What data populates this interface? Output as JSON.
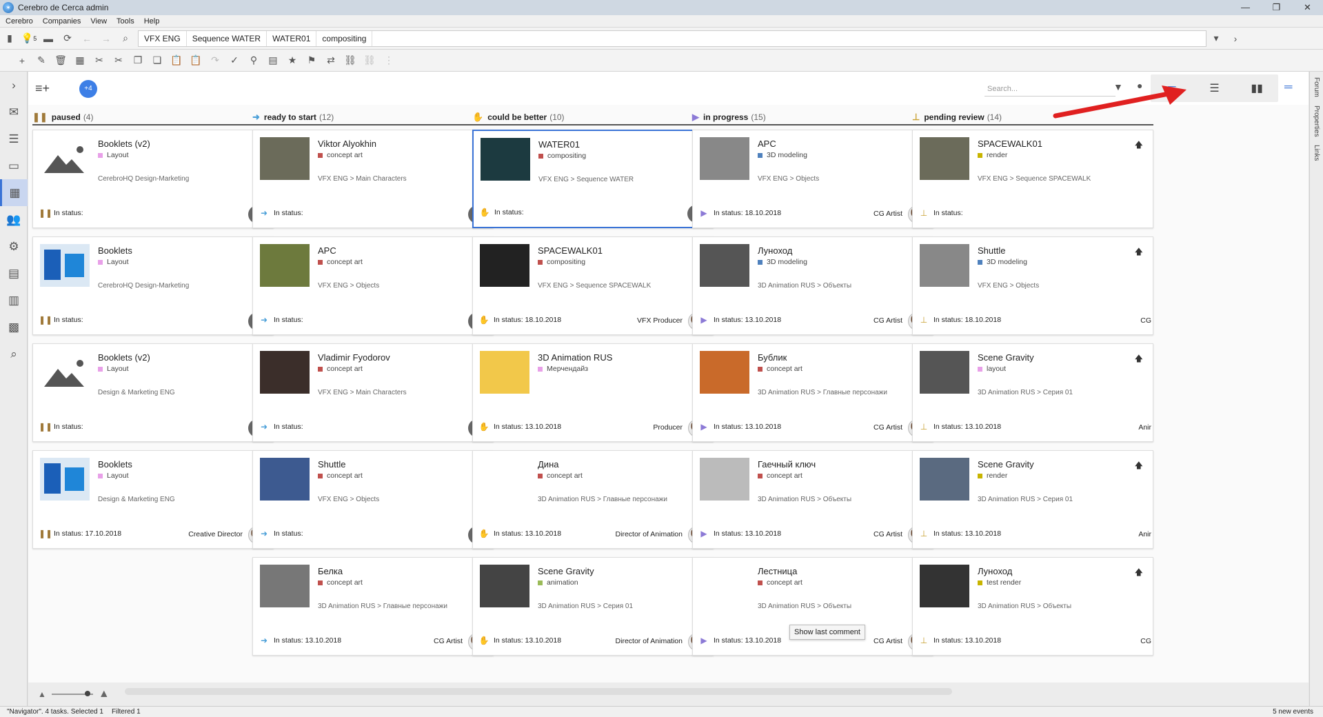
{
  "window": {
    "title": "Cerebro de Cerca  admin"
  },
  "menu": [
    "Cerebro",
    "Companies",
    "View",
    "Tools",
    "Help"
  ],
  "nav": {
    "badge": "5",
    "crumbs": [
      "VFX ENG",
      "Sequence WATER",
      "WATER01",
      "compositing"
    ]
  },
  "main": {
    "plus_badge": "+4",
    "search_placeholder": "Search..."
  },
  "rightbar": [
    "Forum",
    "Properties",
    "Links"
  ],
  "tooltip": "Show last comment",
  "status": {
    "left": "\"Navigator\". 4 tasks. Selected 1",
    "filtered": "Filtered 1",
    "right": "5 new events"
  },
  "columns": [
    {
      "name": "paused",
      "count": "(4)",
      "icon": "pause-icon",
      "cards": [
        {
          "title": "Booklets (v2)",
          "type": "Layout",
          "type_color": "#e8a0e8",
          "path": "CerebroHQ Design-Marketing",
          "status": "In status:",
          "role": "",
          "thumb": "placeholder",
          "ava": "grey"
        },
        {
          "title": "Booklets",
          "type": "Layout",
          "type_color": "#e8a0e8",
          "path": "CerebroHQ Design-Marketing",
          "status": "In status:",
          "role": "",
          "thumb": "booklet",
          "ava": "grey"
        },
        {
          "title": "Booklets (v2)",
          "type": "Layout",
          "type_color": "#e8a0e8",
          "path": "Design & Marketing ENG",
          "status": "In status:",
          "role": "",
          "thumb": "placeholder",
          "ava": "grey"
        },
        {
          "title": "Booklets",
          "type": "Layout",
          "type_color": "#e8a0e8",
          "path": "Design & Marketing ENG",
          "status": "In status: 17.10.2018",
          "role": "Creative Director",
          "thumb": "booklet",
          "ava": "photo"
        }
      ]
    },
    {
      "name": "ready to start",
      "count": "(12)",
      "icon": "arrow-right-icon",
      "cards": [
        {
          "title": "Viktor Alyokhin",
          "type": "concept art",
          "type_color": "#c0504d",
          "path": "VFX ENG > Main Characters",
          "status": "In status:",
          "role": "",
          "thumb": "astronaut",
          "ava": "grey"
        },
        {
          "title": "APC",
          "type": "concept art",
          "type_color": "#c0504d",
          "path": "VFX ENG > Objects",
          "status": "In status:",
          "role": "",
          "thumb": "vehicle",
          "ava": "grey"
        },
        {
          "title": "Vladimir Fyodorov",
          "type": "concept art",
          "type_color": "#c0504d",
          "path": "VFX ENG > Main Characters",
          "status": "In status:",
          "role": "",
          "thumb": "people",
          "ava": "grey"
        },
        {
          "title": "Shuttle",
          "type": "concept art",
          "type_color": "#c0504d",
          "path": "VFX ENG > Objects",
          "status": "In status:",
          "role": "",
          "thumb": "shuttle",
          "ava": "grey"
        },
        {
          "title": "Белка",
          "type": "concept art",
          "type_color": "#c0504d",
          "path": "3D Animation RUS > Главные персонажи",
          "status": "In status: 13.10.2018",
          "role": "CG Artist",
          "thumb": "dogs",
          "ava": "photo"
        }
      ]
    },
    {
      "name": "could be better",
      "count": "(10)",
      "icon": "hand-icon",
      "cards": [
        {
          "title": "WATER01",
          "type": "compositing",
          "type_color": "#c0504d",
          "path": "VFX ENG > Sequence WATER",
          "status": "In status:",
          "role": "",
          "thumb": "water",
          "ava": "grey",
          "selected": true
        },
        {
          "title": "SPACEWALK01",
          "type": "compositing",
          "type_color": "#c0504d",
          "path": "VFX ENG > Sequence SPACEWALK",
          "status": "In status: 18.10.2018",
          "role": "VFX Producer",
          "thumb": "space",
          "ava": "photo"
        },
        {
          "title": "3D Animation RUS",
          "type": "Мерчендайз",
          "type_color": "#e8a0e8",
          "path": "",
          "status": "In status: 13.10.2018",
          "role": "Producer",
          "thumb": "puppy",
          "ava": "photo"
        },
        {
          "title": "Дина",
          "type": "concept art",
          "type_color": "#c0504d",
          "path": "3D Animation RUS > Главные персонажи",
          "status": "In status: 13.10.2018",
          "role": "Director of Animation",
          "thumb": "puppy2",
          "ava": "photo"
        },
        {
          "title": "Scene Gravity",
          "type": "animation",
          "type_color": "#9bbb59",
          "path": "3D Animation RUS > Серия 01",
          "status": "In status: 13.10.2018",
          "role": "Director of Animation",
          "thumb": "scene",
          "ava": "photo"
        }
      ]
    },
    {
      "name": "in progress",
      "count": "(15)",
      "icon": "play-icon",
      "cards": [
        {
          "title": "APC",
          "type": "3D modeling",
          "type_color": "#4f81bd",
          "path": "VFX ENG > Objects",
          "status": "In status: 18.10.2018",
          "role": "CG Artist",
          "thumb": "vehicle_grey",
          "ava": "photo"
        },
        {
          "title": "Луноход",
          "type": "3D modeling",
          "type_color": "#4f81bd",
          "path": "3D Animation RUS > Объекты",
          "status": "In status: 13.10.2018",
          "role": "CG Artist",
          "thumb": "rover",
          "ava": "photo"
        },
        {
          "title": "Бублик",
          "type": "concept art",
          "type_color": "#c0504d",
          "path": "3D Animation RUS > Главные персонажи",
          "status": "In status: 13.10.2018",
          "role": "CG Artist",
          "thumb": "dog3",
          "ava": "photo"
        },
        {
          "title": "Гаечный ключ",
          "type": "concept art",
          "type_color": "#c0504d",
          "path": "3D Animation RUS > Объекты",
          "status": "In status: 13.10.2018",
          "role": "CG Artist",
          "thumb": "wrench",
          "ava": "photo"
        },
        {
          "title": "Лестница",
          "type": "concept art",
          "type_color": "#c0504d",
          "path": "3D Animation RUS > Объекты",
          "status": "In status: 13.10.2018",
          "role": "CG Artist",
          "thumb": "ladder",
          "ava": "photo"
        }
      ]
    },
    {
      "name": "pending review",
      "count": "(14)",
      "icon": "stamp-icon",
      "cards": [
        {
          "title": "SPACEWALK01",
          "type": "render",
          "type_color": "#c8b400",
          "path": "VFX ENG > Sequence SPACEWALK",
          "status": "In status:",
          "role": "",
          "thumb": "astronaut",
          "ava": "none"
        },
        {
          "title": "Shuttle",
          "type": "3D modeling",
          "type_color": "#4f81bd",
          "path": "VFX ENG > Objects",
          "status": "In status: 18.10.2018",
          "role": "CG",
          "thumb": "plane",
          "ava": "none"
        },
        {
          "title": "Scene Gravity",
          "type": "layout",
          "type_color": "#e8a0e8",
          "path": "3D Animation RUS > Серия 01",
          "status": "In status: 13.10.2018",
          "role": "Anir",
          "thumb": "scene2",
          "ava": "none"
        },
        {
          "title": "Scene Gravity",
          "type": "render",
          "type_color": "#c8b400",
          "path": "3D Animation RUS > Серия 01",
          "status": "In status: 13.10.2018",
          "role": "Anir",
          "thumb": "scene3",
          "ava": "none"
        },
        {
          "title": "Луноход",
          "type": "test render",
          "type_color": "#c8b400",
          "path": "3D Animation RUS > Объекты",
          "status": "In status: 13.10.2018",
          "role": "CG",
          "thumb": "rover2",
          "ava": "none"
        }
      ]
    }
  ]
}
